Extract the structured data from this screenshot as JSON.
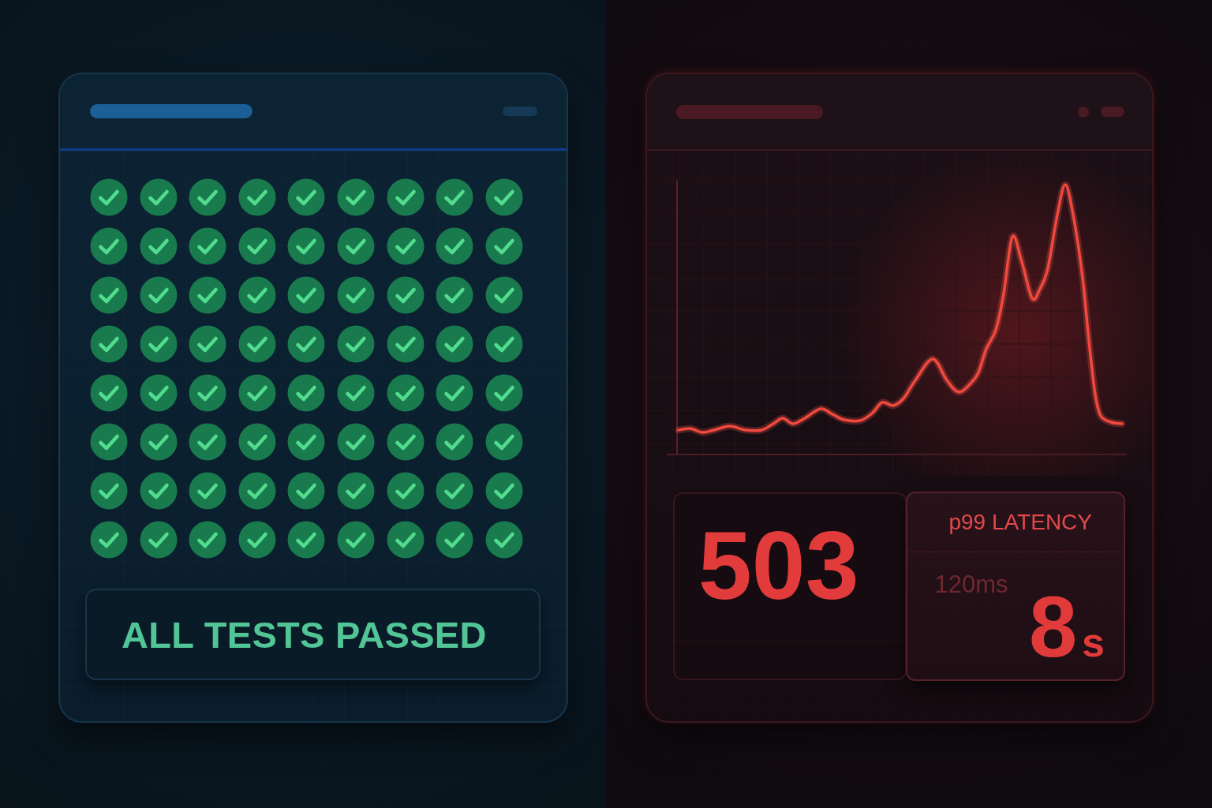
{
  "left_panel": {
    "tests": [
      {
        "passed": true
      },
      {
        "passed": true
      },
      {
        "passed": true
      },
      {
        "passed": true
      },
      {
        "passed": true
      },
      {
        "passed": true
      },
      {
        "passed": true
      },
      {
        "passed": true
      },
      {
        "passed": true
      },
      {
        "passed": true
      },
      {
        "passed": true
      },
      {
        "passed": true
      },
      {
        "passed": true
      },
      {
        "passed": true
      },
      {
        "passed": true
      },
      {
        "passed": true
      },
      {
        "passed": true
      },
      {
        "passed": true
      },
      {
        "passed": true
      },
      {
        "passed": true
      },
      {
        "passed": true
      },
      {
        "passed": true
      },
      {
        "passed": true
      },
      {
        "passed": true
      },
      {
        "passed": true
      },
      {
        "passed": true
      },
      {
        "passed": true
      },
      {
        "passed": true
      },
      {
        "passed": true
      },
      {
        "passed": true
      },
      {
        "passed": true
      },
      {
        "passed": true
      },
      {
        "passed": true
      },
      {
        "passed": true
      },
      {
        "passed": true
      },
      {
        "passed": true
      },
      {
        "passed": true
      },
      {
        "passed": true
      },
      {
        "passed": true
      },
      {
        "passed": true
      },
      {
        "passed": true
      },
      {
        "passed": true
      },
      {
        "passed": true
      },
      {
        "passed": true
      },
      {
        "passed": true
      },
      {
        "passed": true
      },
      {
        "passed": true
      },
      {
        "passed": true
      },
      {
        "passed": true
      },
      {
        "passed": true
      },
      {
        "passed": true
      },
      {
        "passed": true
      },
      {
        "passed": true
      },
      {
        "passed": true
      },
      {
        "passed": true
      },
      {
        "passed": true
      },
      {
        "passed": true
      },
      {
        "passed": true
      },
      {
        "passed": true
      },
      {
        "passed": true
      },
      {
        "passed": true
      },
      {
        "passed": true
      },
      {
        "passed": true
      },
      {
        "passed": true
      },
      {
        "passed": true
      },
      {
        "passed": true
      },
      {
        "passed": true
      },
      {
        "passed": true
      },
      {
        "passed": true
      },
      {
        "passed": true
      },
      {
        "passed": true
      },
      {
        "passed": true
      }
    ],
    "status_banner": {
      "label": "ALL TESTS PASSED"
    }
  },
  "right_panel": {
    "status_code": "503",
    "latency_card": {
      "title": "p99 LATENCY",
      "baseline": "120ms",
      "value": "8",
      "unit": "s"
    }
  }
}
